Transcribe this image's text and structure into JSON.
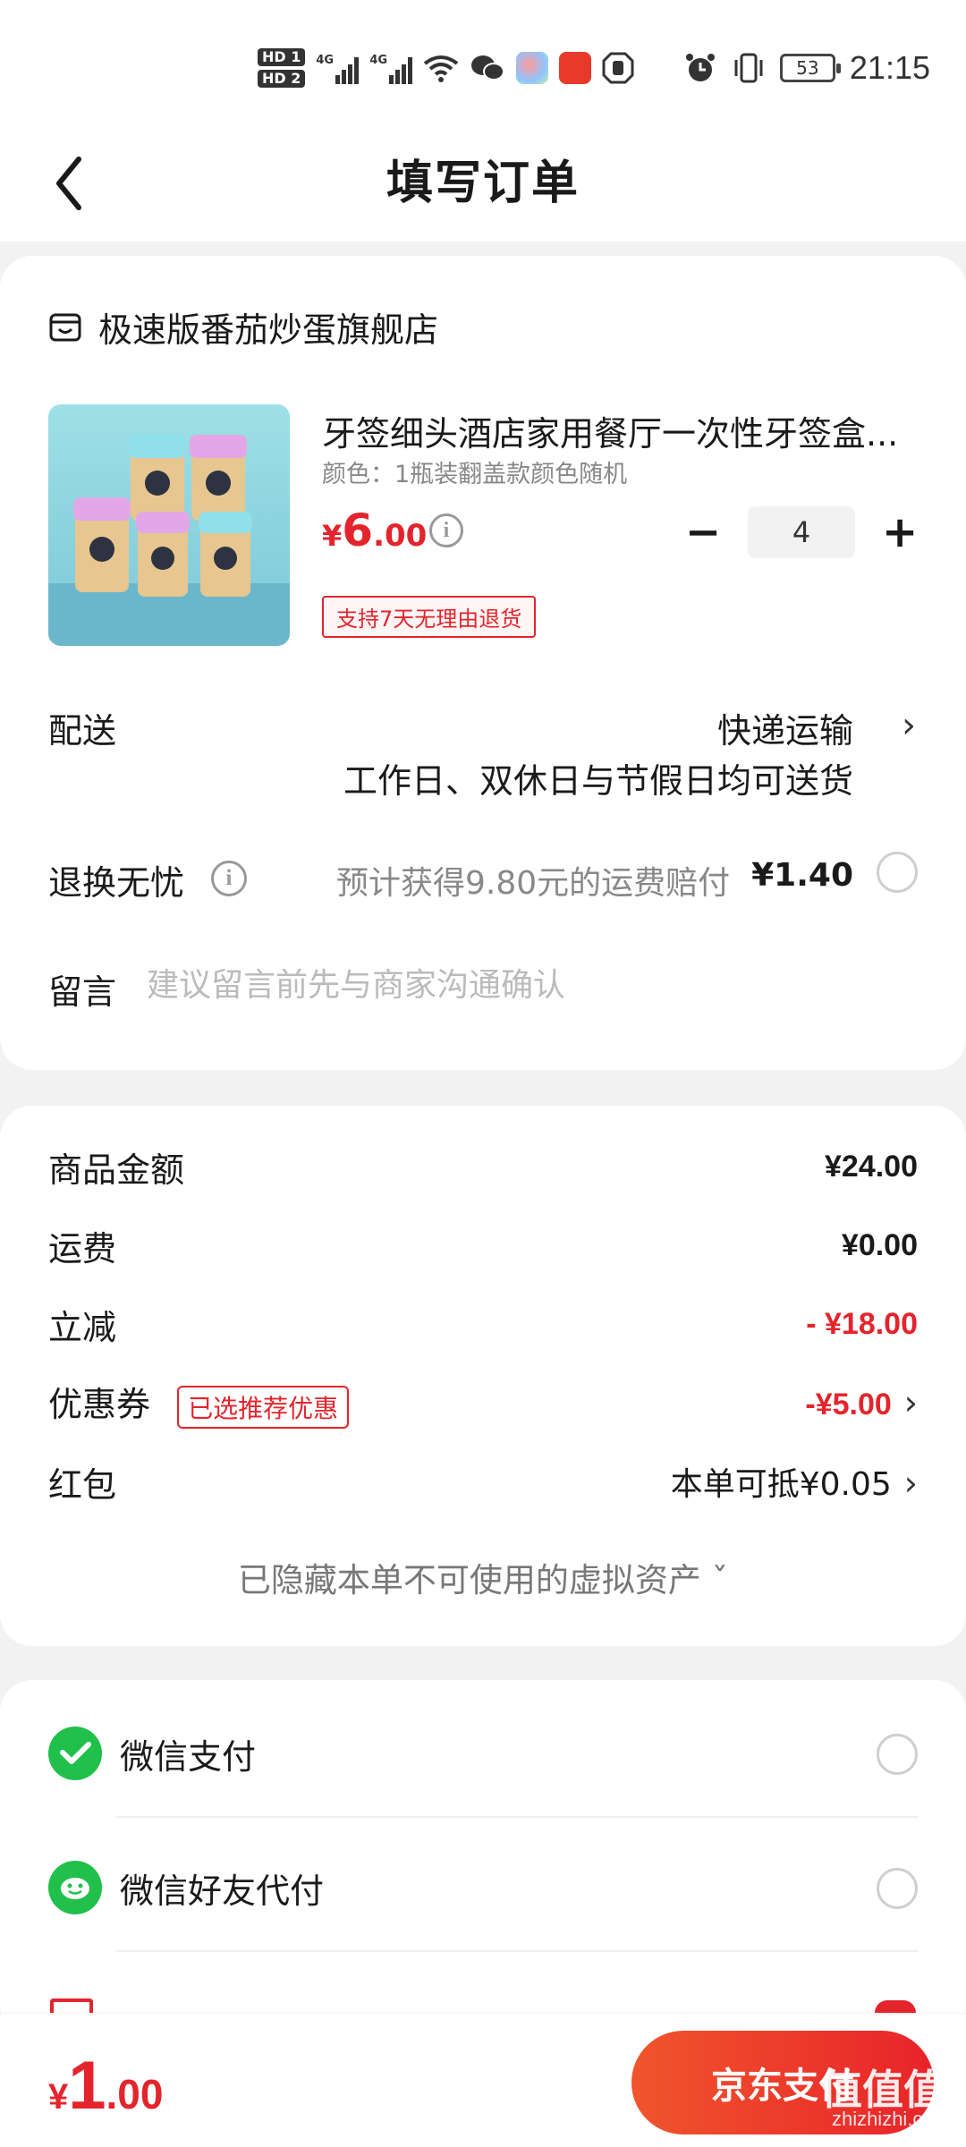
{
  "status_bar": {
    "sim1": "HD 1",
    "sim2": "HD 2",
    "network1": "4G",
    "network2": "4G",
    "battery": "53",
    "time": "21:15",
    "icons": [
      "wifi-icon",
      "wechat-icon",
      "app-icon",
      "taobao-icon",
      "hand-icon",
      "alarm-icon",
      "vibrate-icon"
    ]
  },
  "header": {
    "title": "填写订单"
  },
  "store": {
    "name": "极速版番茄炒蛋旗舰店"
  },
  "product": {
    "name": "牙签细头酒店家用餐厅一次性牙签盒...",
    "spec": "颜色：1瓶装翻盖款颜色随机",
    "price_currency": "¥",
    "price_int": "6",
    "price_dec": ".00",
    "quantity": "4",
    "minus_label": "−",
    "plus_label": "+",
    "return_tag": "支持7天无理由退货"
  },
  "delivery": {
    "label": "配送",
    "method": "快递运输",
    "note": "工作日、双休日与节假日均可送货"
  },
  "return_insurance": {
    "label": "退换无忧",
    "text": "预计获得9.80元的运费赔付",
    "price": "¥1.40"
  },
  "message": {
    "label": "留言",
    "placeholder": "建议留言前先与商家沟通确认"
  },
  "summary": {
    "goods_label": "商品金额",
    "goods_value": "¥24.00",
    "shipping_label": "运费",
    "shipping_value": "¥0.00",
    "discount_label": "立减",
    "discount_value": "- ¥18.00",
    "coupon_label": "优惠券",
    "coupon_tag": "已选推荐优惠",
    "coupon_value": "-¥5.00",
    "redpacket_label": "红包",
    "redpacket_value": "本单可抵¥0.05",
    "hidden_assets": "已隐藏本单不可使用的虚拟资产 ˇ"
  },
  "payment": {
    "options": [
      {
        "label": "微信支付",
        "icon": "wechat-pay-icon"
      },
      {
        "label": "微信好友代付",
        "icon": "wechat-friend-pay-icon"
      }
    ]
  },
  "footer": {
    "total_currency": "¥",
    "total_int": "1",
    "total_dec": ".00",
    "pay_button": "京东支付",
    "watermark_logo": "值值值",
    "watermark_url": "zhizhizhi.com"
  },
  "colors": {
    "accent_red": "#e4242c",
    "wechat_green": "#20c04a",
    "page_bg": "#f2f2f2"
  }
}
